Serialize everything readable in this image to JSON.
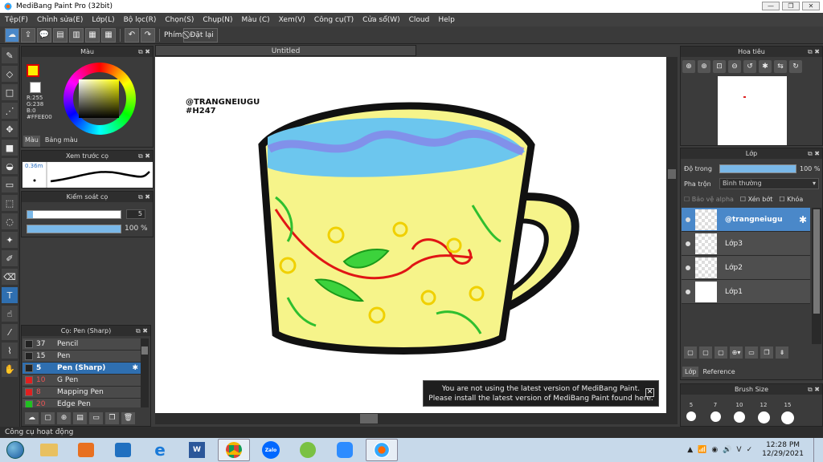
{
  "window": {
    "title": "MediBang Paint Pro (32bit)"
  },
  "menu": [
    "Tệp(F)",
    "Chỉnh sửa(E)",
    "Lớp(L)",
    "Bộ lọc(R)",
    "Chọn(S)",
    "Chụp(N)",
    "Màu (C)",
    "Xem(V)",
    "Công cụ(T)",
    "Cửa sổ(W)",
    "Cloud",
    "Help"
  ],
  "toolbar": {
    "key_label": "Phím",
    "reset_label": "Đặt lại"
  },
  "color_panel": {
    "title": "Màu",
    "values": "R:255\nG:238\nB:0\n#FFEE00",
    "tab_color": "Màu",
    "tab_palette": "Bảng màu",
    "fg_color": "#ffee00"
  },
  "preview_panel": {
    "title": "Xem trước cọ",
    "size_label": "0.36m"
  },
  "brush_control": {
    "title": "Kiểm soát cọ",
    "size_value": "5",
    "opacity_value": "100 %",
    "size_fraction": 0.05,
    "opacity_fraction": 1.0
  },
  "brush_panel": {
    "title": "Cọ: Pen (Sharp)",
    "items": [
      {
        "size": "37",
        "name": "Pencil",
        "color": "#222222",
        "active": false
      },
      {
        "size": "15",
        "name": "Pen",
        "color": "#222222",
        "active": false
      },
      {
        "size": "5",
        "name": "Pen (Sharp)",
        "color": "#222222",
        "active": true
      },
      {
        "size": "10",
        "name": "G Pen",
        "color": "#e02020",
        "active": false
      },
      {
        "size": "8",
        "name": "Mapping Pen",
        "color": "#e02020",
        "active": false
      },
      {
        "size": "20",
        "name": "Edge Pen",
        "color": "#20c020",
        "active": false
      }
    ]
  },
  "canvas": {
    "tab_title": "Untitled",
    "watermark_line1": "@TRANGNEIUGU",
    "watermark_line2": "#H247"
  },
  "notice": {
    "line1": "You are not using the latest version of MediBang Paint.",
    "line2": "Please install the latest version of MediBang Paint found here.",
    "close": "✕"
  },
  "navigator": {
    "title": "Hoa tiêu"
  },
  "layer_panel": {
    "title": "Lớp",
    "opacity_label": "Độ trong",
    "opacity_value": "100 %",
    "opacity_fraction": 1.0,
    "blend_label": "Pha trộn",
    "blend_value": "Bình thường",
    "protect_alpha": "Bảo vệ alpha",
    "clipping": "Xén bớt",
    "lock": "Khóa",
    "layers": [
      {
        "name": "@trangneiugu",
        "active": true
      },
      {
        "name": "Lớp3",
        "active": false
      },
      {
        "name": "Lớp2",
        "active": false
      },
      {
        "name": "Lớp1",
        "active": false
      }
    ],
    "tab_layer": "Lớp",
    "tab_reference": "Reference"
  },
  "brush_size": {
    "title": "Brush Size",
    "sizes": [
      "5",
      "7",
      "10",
      "12",
      "15"
    ]
  },
  "status": {
    "text": "Công cụ hoạt động"
  },
  "taskbar": {
    "time": "12:28 PM",
    "date": "12/29/2021",
    "zalo": "Zalo"
  }
}
